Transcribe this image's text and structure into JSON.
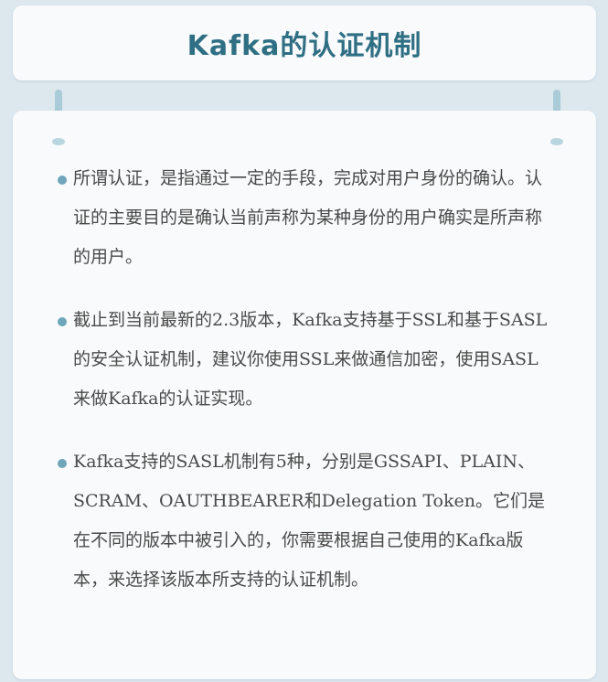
{
  "header": {
    "title": "Kafka的认证机制"
  },
  "bullets": [
    {
      "text": "所谓认证，是指通过一定的手段，完成对用户身份的确认。认证的主要目的是确认当前声称为某种身份的用户确实是所声称的用户。"
    },
    {
      "text": "截止到当前最新的2.3版本，Kafka支持基于SSL和基于SASL的安全认证机制，建议你使用SSL来做通信加密，使用SASL来做Kafka的认证实现。"
    },
    {
      "text": "Kafka支持的SASL机制有5种，分别是GSSAPI、PLAIN、SCRAM、OAUTHBEARER和Delegation Token。它们是在不同的版本中被引入的，你需要根据自己使用的Kafka版本，来选择该版本所支持的认证机制。"
    }
  ],
  "colors": {
    "background": "#dce7ee",
    "card": "#f9fafb",
    "title": "#2f6f84",
    "bullet": "#6fa6bb",
    "connector": "#a9ccd8",
    "text": "#4a4a4a"
  }
}
